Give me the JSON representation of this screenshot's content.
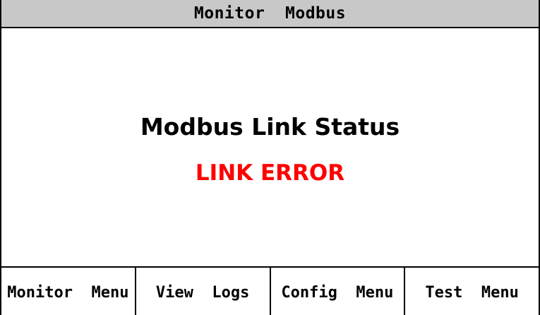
{
  "header": {
    "title": "Monitor  Modbus"
  },
  "main": {
    "status_label": "Modbus Link Status",
    "status_value": "LINK ERROR",
    "status_color": "#ff0000"
  },
  "softkeys": [
    {
      "label": "Monitor  Menu"
    },
    {
      "label": "View  Logs"
    },
    {
      "label": "Config  Menu"
    },
    {
      "label": "Test  Menu"
    }
  ],
  "colors": {
    "titlebar_bg": "#c8c8c8",
    "error": "#ff0000"
  }
}
